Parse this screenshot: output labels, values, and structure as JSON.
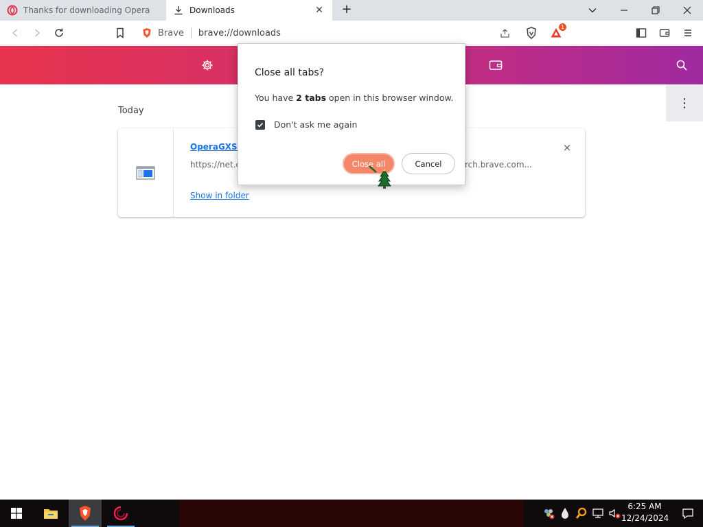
{
  "browser": {
    "tabs": [
      {
        "title": "Thanks for downloading Opera",
        "active": false
      },
      {
        "title": "Downloads",
        "active": true
      }
    ],
    "new_tab_glyph": "+",
    "window_controls": [
      "chevron-down-icon",
      "minimize-icon",
      "restore-icon",
      "close-icon"
    ]
  },
  "toolbar": {
    "site_label": "Brave",
    "url": "brave://downloads",
    "rewards_badge": "1"
  },
  "downloads": {
    "day_label": "Today",
    "items": [
      {
        "file_name_visible": "OperaGXSet",
        "url_left_visible": "https://net.c",
        "url_right_visible": "rch.brave.com...",
        "show_in_folder": "Show in folder",
        "remove_glyph": "×"
      }
    ],
    "menu_glyph": "⋮"
  },
  "dialog": {
    "title": "Close all tabs?",
    "message_before": "You have ",
    "message_bold": "2 tabs",
    "message_after": " open in this browser window.",
    "checkbox_label": "Don't ask me again",
    "checkbox_checked": true,
    "primary_button": "Close all",
    "secondary_button": "Cancel"
  },
  "taskbar": {
    "time": "6:25 AM",
    "date": "12/24/2024",
    "apps": [
      "windows-start-icon",
      "file-explorer-icon",
      "brave-browser-icon",
      "opera-gx-icon"
    ]
  },
  "colors": {
    "header_gradient_start": "#e8344e",
    "header_gradient_end": "#9f2aa0",
    "primary_button": "#f4866a",
    "link": "#1a73e8"
  }
}
